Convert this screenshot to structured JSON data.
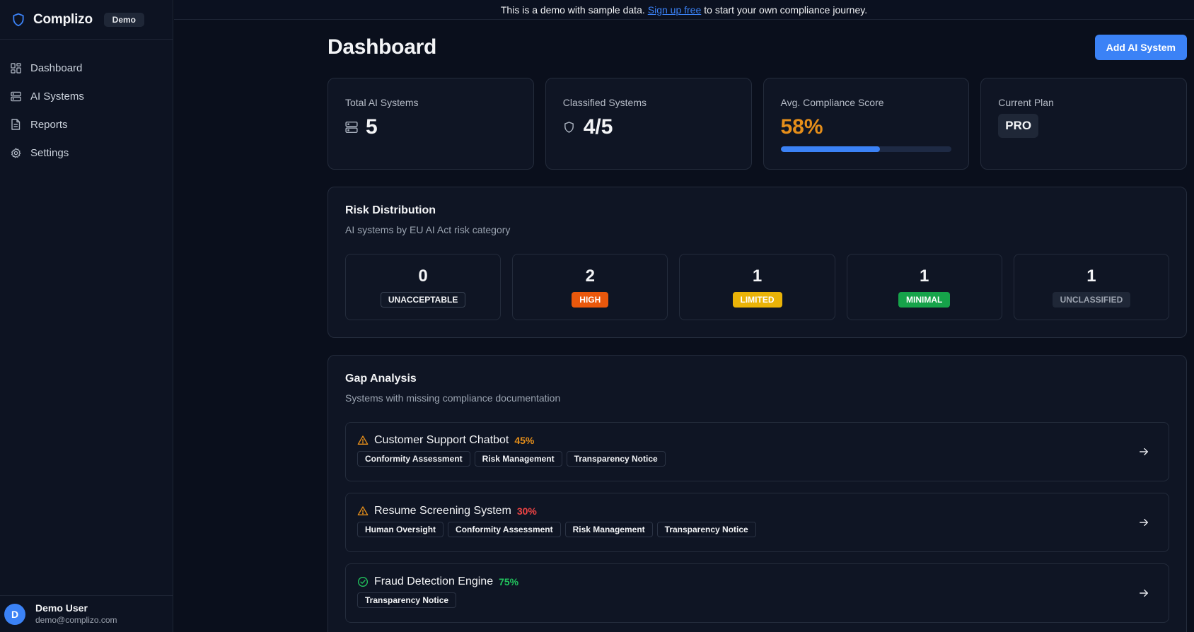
{
  "app": {
    "name": "Complizo",
    "mode_badge": "Demo"
  },
  "sidebar": {
    "items": [
      {
        "label": "Dashboard",
        "icon": "grid-icon"
      },
      {
        "label": "AI Systems",
        "icon": "server-icon"
      },
      {
        "label": "Reports",
        "icon": "file-text-icon"
      },
      {
        "label": "Settings",
        "icon": "gear-icon"
      }
    ]
  },
  "user": {
    "initial": "D",
    "name": "Demo User",
    "email": "demo@complizo.com"
  },
  "banner": {
    "prefix": "This is a demo with sample data.",
    "link": "Sign up free",
    "suffix": "to start your own compliance journey."
  },
  "header": {
    "title": "Dashboard",
    "add_button": "Add AI System"
  },
  "stats": {
    "total": {
      "label": "Total AI Systems",
      "value": "5"
    },
    "classified": {
      "label": "Classified Systems",
      "value": "4/5"
    },
    "compliance": {
      "label": "Avg. Compliance Score",
      "value": "58%",
      "progress": 0.58
    },
    "plan": {
      "label": "Current Plan",
      "value": "PRO"
    }
  },
  "risk": {
    "title": "Risk Distribution",
    "subtitle": "AI systems by EU AI Act risk category",
    "categories": [
      {
        "count": "0",
        "label": "UNACCEPTABLE",
        "bg": "#111827",
        "fg": "#f3f4f6",
        "border": "#374151"
      },
      {
        "count": "2",
        "label": "HIGH",
        "bg": "#ea580c",
        "fg": "#ffffff",
        "border": "#ea580c"
      },
      {
        "count": "1",
        "label": "LIMITED",
        "bg": "#eab308",
        "fg": "#ffffff",
        "border": "#eab308"
      },
      {
        "count": "1",
        "label": "MINIMAL",
        "bg": "#16a34a",
        "fg": "#ffffff",
        "border": "#16a34a"
      },
      {
        "count": "1",
        "label": "UNCLASSIFIED",
        "bg": "#1f2737",
        "fg": "#9ca3af",
        "border": "#1f2737"
      }
    ]
  },
  "gap": {
    "title": "Gap Analysis",
    "subtitle": "Systems with missing compliance documentation",
    "items": [
      {
        "name": "Customer Support Chatbot",
        "percent": "45%",
        "percent_color": "#e58e1a",
        "status_icon": "warning-icon",
        "tags": [
          "Conformity Assessment",
          "Risk Management",
          "Transparency Notice"
        ]
      },
      {
        "name": "Resume Screening System",
        "percent": "30%",
        "percent_color": "#ef4444",
        "status_icon": "warning-icon",
        "tags": [
          "Human Oversight",
          "Conformity Assessment",
          "Risk Management",
          "Transparency Notice"
        ]
      },
      {
        "name": "Fraud Detection Engine",
        "percent": "75%",
        "percent_color": "#22c55e",
        "status_icon": "check-circle-icon",
        "tags": [
          "Transparency Notice"
        ]
      }
    ]
  },
  "colors": {
    "accent": "#3b82f6",
    "warning": "#e58e1a",
    "success": "#22c55e"
  }
}
